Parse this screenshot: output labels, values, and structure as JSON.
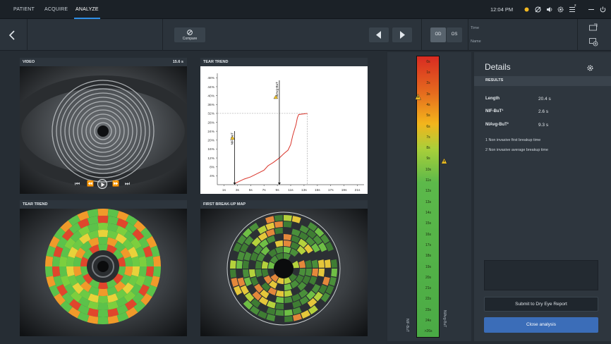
{
  "nav": {
    "items": [
      "PATIENT",
      "ACQUIRE",
      "ANALYZE"
    ],
    "active": "ANALYZE"
  },
  "status": {
    "time": "12:04 PM"
  },
  "toolbar": {
    "compare_label": "Compare",
    "od_label": "OD",
    "os_label": "OS",
    "time_label": "Time",
    "name_label": "Name"
  },
  "video_panel": {
    "title": "VIDEO",
    "duration": "15.6 s"
  },
  "tear_trend_chart_panel": {
    "title": "TEAR TREND"
  },
  "tear_trend_map_panel": {
    "title": "TEAR TREND"
  },
  "breakup_map_panel": {
    "title": "FIRST BREAK-UP MAP"
  },
  "chart_data": {
    "type": "line",
    "title": "",
    "xlabel": "",
    "ylabel": "",
    "x_ticks": [
      "1s",
      "3s",
      "5s",
      "7s",
      "9s",
      "11s",
      "13s",
      "15s",
      "17s",
      "19s",
      "21s"
    ],
    "y_ticks": [
      "4%",
      "8%",
      "12%",
      "16%",
      "20%",
      "24%",
      "28%",
      "32%",
      "36%",
      "40%",
      "44%",
      "48%"
    ],
    "xlim": [
      0,
      22
    ],
    "ylim": [
      0,
      50
    ],
    "series": [
      {
        "x": [
          2.6,
          4,
          5,
          6,
          7,
          7.6,
          8.4,
          9.3,
          10,
          10.6,
          11,
          11.3,
          11.8,
          12,
          12.2,
          13.5
        ],
        "y": [
          0.5,
          2.5,
          3.5,
          5,
          6.5,
          8.5,
          10,
          12,
          14,
          15.5,
          18,
          22,
          27,
          30,
          31.5,
          32
        ]
      }
    ],
    "markers": [
      {
        "label": "NIF-BuT",
        "x": 2.6
      },
      {
        "label": "NIAvg-BuT",
        "x": 9.3
      }
    ],
    "threshold_y": 32,
    "end_x": 13.5
  },
  "scale": {
    "ticks": [
      "0s",
      "1s",
      "2s",
      "3s",
      "4s",
      "5s",
      "6s",
      "7s",
      "8s",
      "9s",
      "10s",
      "11s",
      "12s",
      "13s",
      "14s",
      "15s",
      "16s",
      "17s",
      "18s",
      "19s",
      "20s",
      "21s",
      "22s",
      "23s",
      "24s",
      ">26s"
    ],
    "left_label": "NIF-BuT",
    "right_label": "NIAvg-BuT",
    "left_marker_at": "3s",
    "right_marker_at": "9s",
    "colors": [
      "#d92b22",
      "#e56b1e",
      "#f3b51c",
      "#a9cf3a",
      "#5cb94a",
      "#4aaa45"
    ]
  },
  "details": {
    "title": "Details",
    "results_header": "RESULTS",
    "rows": [
      {
        "label": "Length",
        "value": "20.4 s"
      },
      {
        "label": "NIF-BuT¹",
        "value": "2.6 s"
      },
      {
        "label": "NIAvg-BuT²",
        "value": "9.3 s"
      }
    ],
    "notes": [
      "1 Non invasive first breakup time",
      "2 Non invasive average breakup time"
    ],
    "submit_label": "Submit to Dry Eye Report",
    "close_label": "Close analysis"
  },
  "icons": [
    "chevron-left-icon",
    "compare-icon",
    "play-previous-icon",
    "play-next-icon",
    "settings-icon",
    "warning-icon",
    "minimize-icon",
    "power-icon",
    "export-icon",
    "add-screen-icon",
    "sun-icon",
    "wifi-icon",
    "volume-icon",
    "list-icon"
  ],
  "status_badge": "2"
}
